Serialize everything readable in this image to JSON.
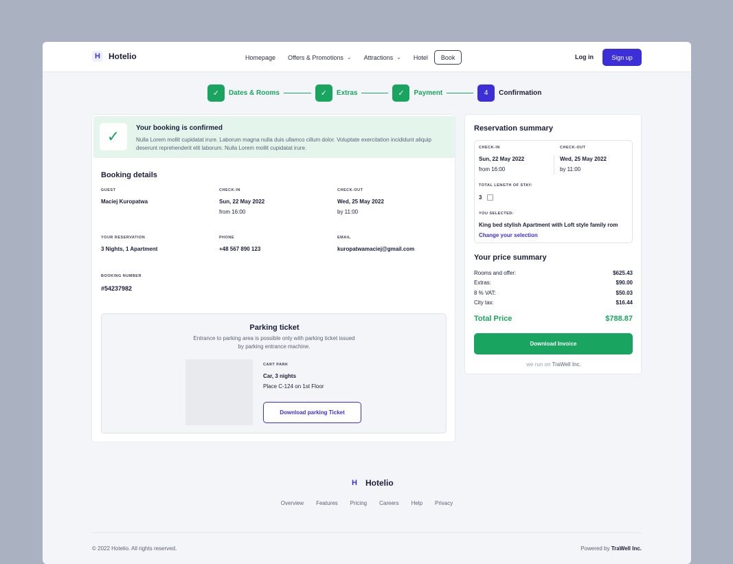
{
  "brand": {
    "logo_letter": "H",
    "name": "Hotelio"
  },
  "nav": {
    "homepage": "Homepage",
    "offers": "Offers & Promotions",
    "attractions": "Attractions",
    "hotel": "Hotel",
    "book": "Book",
    "login": "Log in",
    "signup": "Sign up"
  },
  "stepper": {
    "steps": [
      {
        "label": "Dates & Rooms",
        "status": "done",
        "icon": "check-icon"
      },
      {
        "label": "Extras",
        "status": "done",
        "icon": "check-icon"
      },
      {
        "label": "Payment",
        "status": "done",
        "icon": "check-icon"
      },
      {
        "label": "Confirmation",
        "status": "current",
        "number": "4"
      }
    ]
  },
  "confirmation": {
    "title": "Your booking is confirmed",
    "text": "Nulla Lorem mollit cupidatat irure. Laborum magna nulla duis ullamco cillum dolor. Voluptate exercitation incididunt aliquip deserunt reprehenderit elit laborum. Nulla Lorem mollit cupidatat irure."
  },
  "booking": {
    "title": "Booking details",
    "guest_label": "GUEST",
    "guest": "Maciej Kuropatwa",
    "checkin_label": "CHECK-IN",
    "checkin_date": "Sun, 22 May 2022",
    "checkin_time": "from 16:00",
    "checkout_label": "CHECK-OUT",
    "checkout_date": "Wed, 25 May 2022",
    "checkout_time": "by 11:00",
    "reservation_label": "YOUR RESERVATION",
    "reservation": "3 Nights, 1 Apartment",
    "phone_label": "PHONE",
    "phone": "+48 567 890 123",
    "email_label": "EMAIL",
    "email": "kuropatwamaciej@gmail.com",
    "number_label": "BOOKING NUMBER",
    "number": "#54237982"
  },
  "parking": {
    "title": "Parking ticket",
    "text": "Entrance to parking area is possible only with parking ticket issued by parking entrance machine.",
    "label": "CART PARK",
    "line1": "Car, 3 nights",
    "line2": "Place C-124 on 1st Floor",
    "button": "Download parking Ticket"
  },
  "summary": {
    "title": "Reservation summary",
    "checkin_label": "CHECK-IN",
    "checkin_date": "Sun, 22 May 2022",
    "checkin_time": "from 16:00",
    "checkout_label": "CHECK-OUT",
    "checkout_date": "Wed, 25 May 2022",
    "checkout_time": "by 11:00",
    "length_label": "TOTAL LENGTH OF STAY:",
    "length": "3",
    "selected_label": "YOU SELECTED:",
    "selected": "King bed stylish Apartment with Loft style family rom",
    "change": "Change your selection"
  },
  "price": {
    "title": "Your price summary",
    "rows": [
      {
        "label": "Rooms and offer:",
        "value": "$625.43"
      },
      {
        "label": "Extras:",
        "value": "$90.00"
      },
      {
        "label": "8 % VAT:",
        "value": "$50.03"
      },
      {
        "label": "City tax:",
        "value": "$16.44"
      }
    ],
    "total_label": "Total Price",
    "total": "$788.87",
    "invoice_button": "Download Invoice",
    "run_on": "we run on",
    "run_on_brand": "TraWell Inc."
  },
  "footer": {
    "links": [
      "Overview",
      "Features",
      "Pricing",
      "Careers",
      "Help",
      "Privacy"
    ],
    "copyright": "© 2022 Hotelio. All rights reserved.",
    "powered": "Powered by",
    "powered_brand": "TraWell Inc."
  },
  "colors": {
    "accent": "#3d2fd8",
    "success": "#19a45f",
    "success_bg": "#e4f5ec"
  }
}
